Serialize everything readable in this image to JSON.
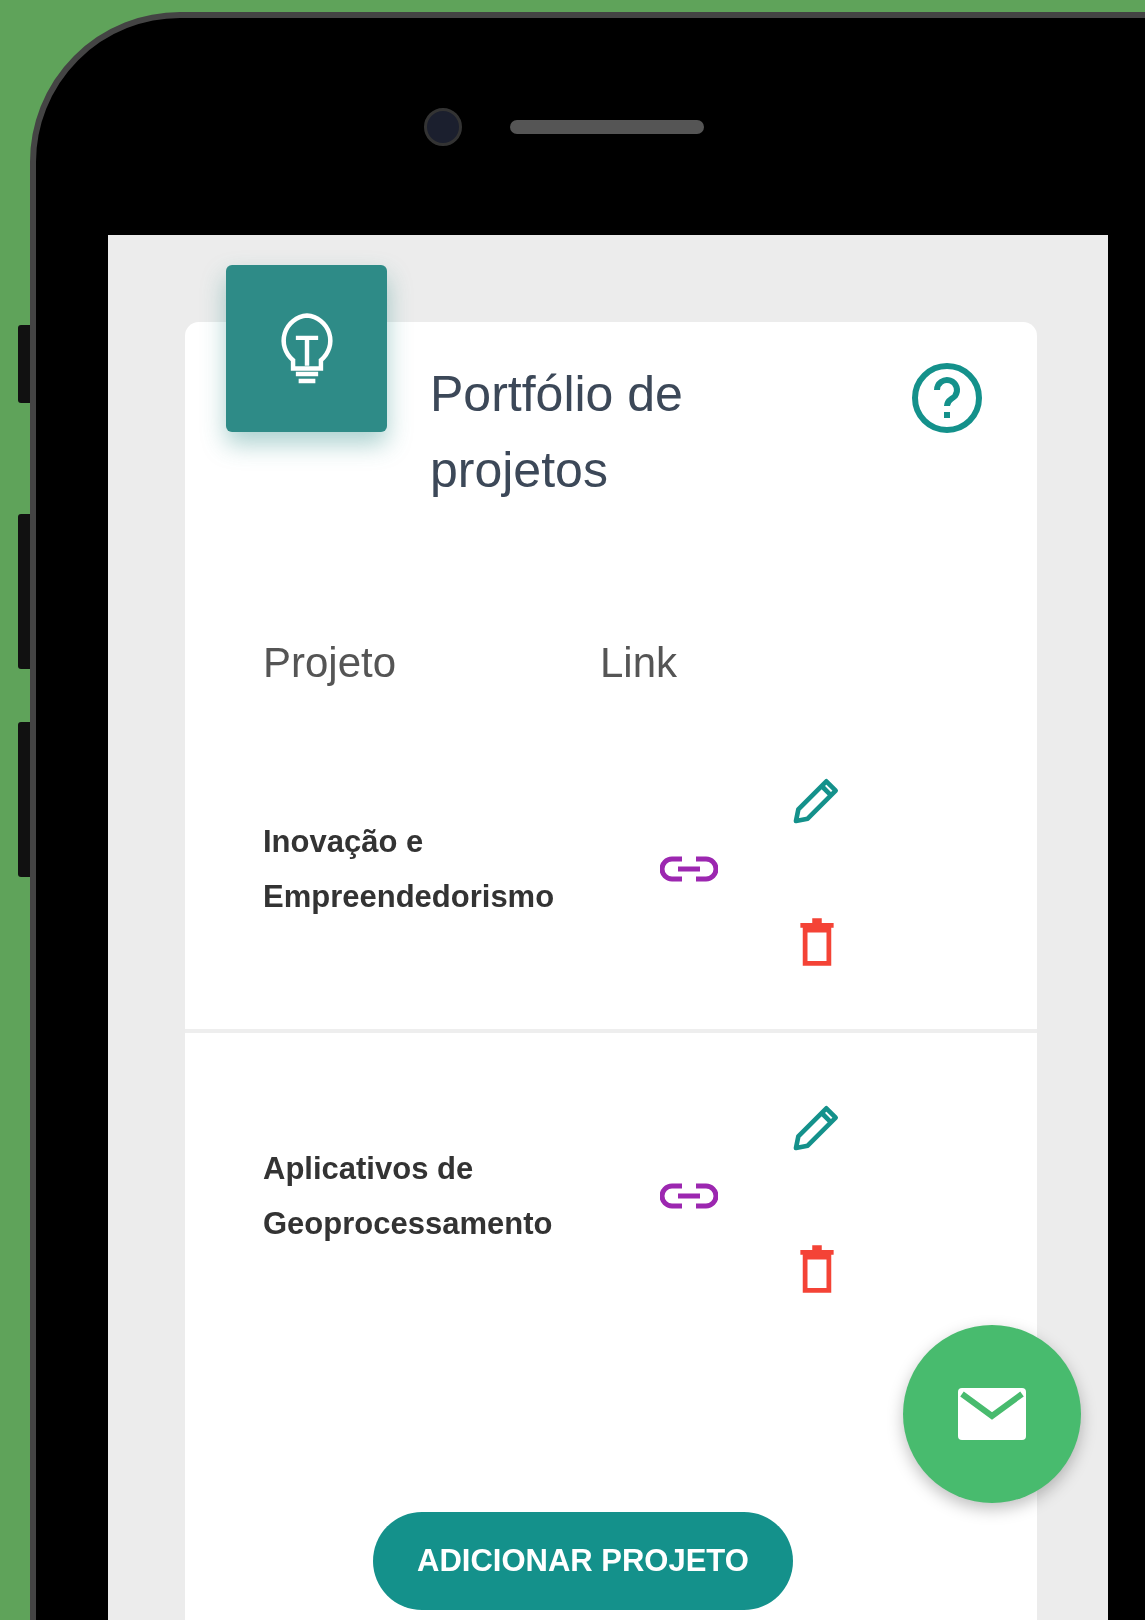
{
  "header": {
    "title": "Portfólio de projetos"
  },
  "columns": [
    "Projeto",
    "Link"
  ],
  "rows": [
    {
      "name": "Inovação e Empreendedorismo"
    },
    {
      "name": "Aplicativos de Geoprocessamento"
    }
  ],
  "add_button": "ADICIONAR PROJETO"
}
